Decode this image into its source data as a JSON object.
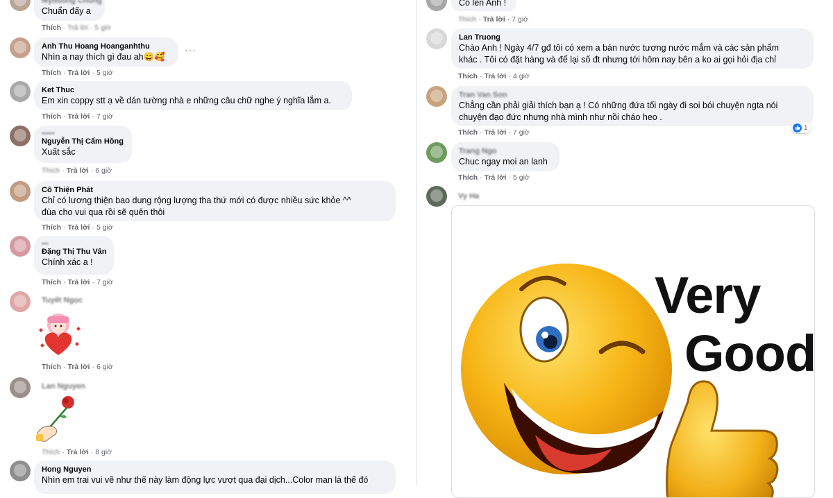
{
  "labels": {
    "like": "Thích",
    "reply": "Trả lời",
    "dot": "·"
  },
  "left_comments": [
    {
      "name": "Myduong Chung",
      "text": "Chuẩn đấy a",
      "time": ""
    },
    {
      "name": "Anh Thu Hoang Hoanganhthu",
      "text": "Nhìn a nay thích gì đau ah😄🥰",
      "time": "5 giờ",
      "more": "···"
    },
    {
      "name": "Ket Thuc",
      "text": "Em xin coppy stt ạ về dán tường nhà e những câu chữ nghe ý nghĩa lắm a.",
      "time": "7 giờ"
    },
    {
      "name": "Nguyễn Thị Cẩm Hồng",
      "text": "Xuất sắc",
      "time": "6 giờ"
    },
    {
      "name": "Cô Thiện Phát",
      "text_lines": [
        "Chỉ có lương thiện bao dung rộng lượng tha thứ mới có được nhiều sức khỏe ^^",
        "đùa cho vui qua rồi sẽ quên thôi"
      ],
      "time": "5 giờ"
    },
    {
      "name": "Đặng Thị Thu Vân",
      "text": "Chính xác a !",
      "time": "7 giờ"
    },
    {
      "name": "",
      "time": "6 giờ",
      "sticker": "heart-sticker"
    },
    {
      "name": "",
      "time": "8 giờ",
      "sticker": "rose-sticker"
    },
    {
      "name": "Hong Nguyen",
      "text": "Nhìn em trai vui vẽ như thế này làm động lực vượt qua đại dịch...Color man là thế đó",
      "time": ""
    }
  ],
  "right_comments": [
    {
      "name": "",
      "text": "Có lên Anh !",
      "time": "7 giờ"
    },
    {
      "name": "Lan Truong",
      "text_lines": [
        "Chào Anh ! Ngày 4/7 gđ tôi có xem a bán nước tương nước mắm và các sản phẩm",
        "khác . Tôi có đặt hàng và để lại số đt nhưng tới hôm nay bên a ko ai gọi hỏi địa chỉ"
      ],
      "time": "4 giờ"
    },
    {
      "name": "Tran Van Son",
      "text_lines": [
        "Chẳng cần phải giải thích bạn ạ ! Có những đứa tối ngày đi soi bói chuyện ngta nói",
        "chuyện đạo đức nhưng nhà mình như nồi cháo heo ."
      ],
      "time": "7 giờ",
      "reaction_count": "1"
    },
    {
      "name": "Trang Ngo",
      "text": "Chuc ngay moi an lanh",
      "time": "5 giờ"
    },
    {
      "name": "",
      "image_text": [
        "Very",
        "Good"
      ]
    }
  ],
  "colors": {
    "bubble": "#f0f2f5",
    "meta": "#65676b",
    "like_blue": "#1877f2",
    "emoji_yellow": "#f7b516"
  }
}
